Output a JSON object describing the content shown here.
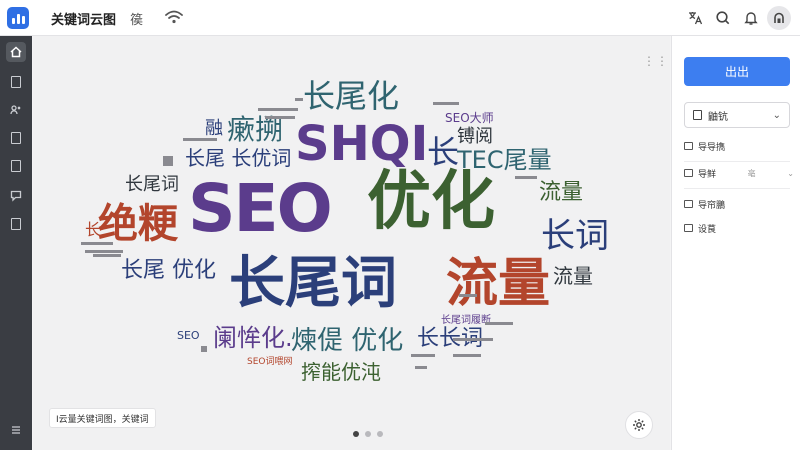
{
  "app": {
    "title": "关键词云图",
    "extra_glyph": "篌"
  },
  "icons": {
    "app": "bar-chart-icon",
    "wifi": "wifi-icon",
    "translate": "translate-icon",
    "search": "search-icon",
    "bell": "bell-icon",
    "user": "user-icon",
    "settings": "gear-icon"
  },
  "sidebar": {
    "items": [
      "home-icon",
      "bookmark-icon",
      "users-icon",
      "file-icon",
      "document-icon",
      "chat-icon",
      "book-icon",
      "menu-icon"
    ]
  },
  "panel": {
    "primary_button": "出出",
    "select_value": "鼬钪",
    "options": [
      {
        "label": "导导擕",
        "right": ""
      },
      {
        "label": "导鲜",
        "right": "亳"
      },
      {
        "label": "导帘鵬",
        "right": ""
      },
      {
        "label": "设茛",
        "right": ""
      }
    ]
  },
  "canvas": {
    "chip_label": "I云量关键词图，关键词",
    "pager_active": 0,
    "pager_count": 3
  },
  "colors": {
    "accent": "#3d7ef0",
    "rail": "#3a3d43",
    "purple": "#5b3c8c",
    "navy": "#2b3f7a",
    "green": "#3c6131",
    "teal": "#2f6470",
    "red": "#b3452c",
    "dark": "#31383f"
  },
  "wordcloud": [
    {
      "text": "SEO",
      "color": "#5b3c8c"
    },
    {
      "text": "优化",
      "color": "#3c6131"
    },
    {
      "text": "长尾词",
      "color": "#2b3f7a"
    },
    {
      "text": "流量",
      "color": "#b3452c"
    },
    {
      "text": "SHQI",
      "color": "#5b3c8c"
    },
    {
      "text": "长尾化",
      "color": "#2f6470"
    },
    {
      "text": "绝粳",
      "color": "#b3452c"
    },
    {
      "text": "长词",
      "color": "#2b3f7a"
    },
    {
      "text": "长尾 长优词",
      "color": "#2b3f7a"
    },
    {
      "text": "TEC尾量",
      "color": "#2f6470"
    },
    {
      "text": "长尾词",
      "color": "#31383f"
    },
    {
      "text": "流量",
      "color": "#3c6131"
    },
    {
      "text": "长尾 优化",
      "color": "#2b3f7a"
    },
    {
      "text": "流量",
      "color": "#31383f"
    },
    {
      "text": "阑恈化.",
      "color": "#5b3c8c"
    },
    {
      "text": "煉偍 优化",
      "color": "#2f6470"
    },
    {
      "text": "长长词",
      "color": "#2b3f7a"
    },
    {
      "text": "搾能优沌",
      "color": "#3c6131"
    },
    {
      "text": "瘶搠",
      "color": "#2f6470"
    },
    {
      "text": "长",
      "color": "#2b3f7a"
    },
    {
      "text": "镈阅",
      "color": "#31383f"
    },
    {
      "text": "融",
      "color": "#2b3f7a"
    },
    {
      "text": "长",
      "color": "#b3452c"
    },
    {
      "text": "SEO大师",
      "color": "#5b3c8c"
    },
    {
      "text": "长尾词履断",
      "color": "#5b3c8c"
    },
    {
      "text": "SEO词喂网",
      "color": "#b3452c"
    },
    {
      "text": "SEO",
      "color": "#2b3f7a"
    }
  ]
}
